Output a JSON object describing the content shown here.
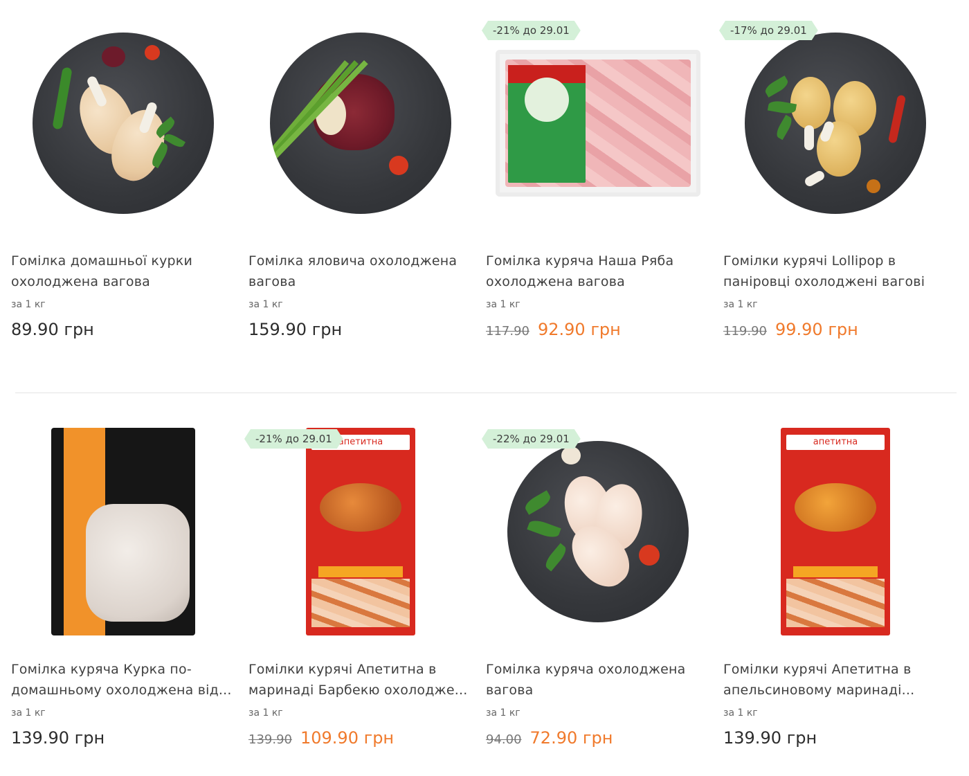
{
  "products": [
    {
      "title": "Гомілка домашньої курки охолоджена вагова",
      "unit": "за 1 кг",
      "price": "89.90 грн",
      "old_price": "",
      "badge": ""
    },
    {
      "title": "Гомілка яловича охолоджена вагова",
      "unit": "за 1 кг",
      "price": "159.90 грн",
      "old_price": "",
      "badge": ""
    },
    {
      "title": "Гомілка куряча Наша Ряба охолоджена вагова",
      "unit": "за 1 кг",
      "price": "92.90 грн",
      "old_price": "117.90",
      "badge": "-21% до 29.01"
    },
    {
      "title": "Гомілки курячі Lollipop в паніровці охолоджені вагові",
      "unit": "за 1 кг",
      "price": "99.90 грн",
      "old_price": "119.90",
      "badge": "-17% до 29.01"
    },
    {
      "title": "Гомілка куряча Курка по-домашньому охолоджена від...",
      "unit": "за 1 кг",
      "price": "139.90 грн",
      "old_price": "",
      "badge": ""
    },
    {
      "title": "Гомілки курячі Апетитна в маринаді Барбекю охолодже...",
      "unit": "за 1 кг",
      "price": "109.90 грн",
      "old_price": "139.90",
      "badge": "-21% до 29.01"
    },
    {
      "title": "Гомілка куряча охолоджена вагова",
      "unit": "за 1 кг",
      "price": "72.90 грн",
      "old_price": "94.00",
      "badge": "-22% до 29.01"
    },
    {
      "title": "Гомілки курячі Апетитна в апельсиновому маринаді...",
      "unit": "за 1 кг",
      "price": "139.90 грн",
      "old_price": "",
      "badge": ""
    }
  ],
  "packaging": {
    "red_pack_brand": "апетитна"
  },
  "colors": {
    "sale_price": "#f07a2c",
    "badge_bg": "#d4f0d8",
    "regular_price": "#2d2d2d"
  }
}
